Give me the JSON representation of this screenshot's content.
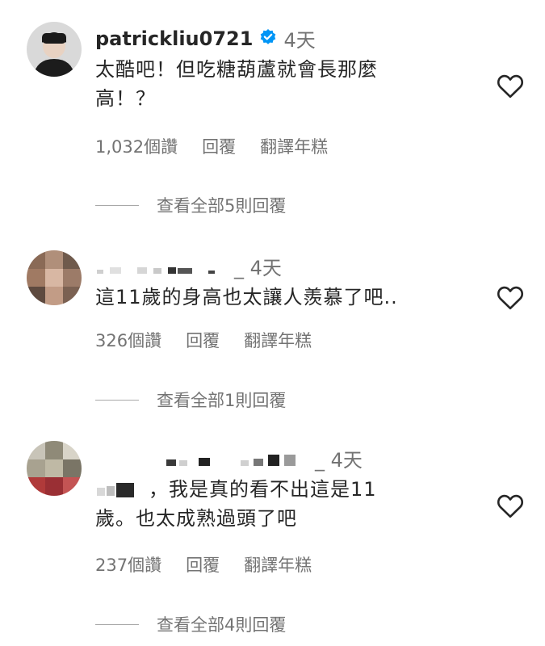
{
  "comments": [
    {
      "username": "patrickliu0721",
      "verified": true,
      "time": "4天",
      "text_line1": "太酷吧！但吃糖葫蘆就會長那麼",
      "text_line2": "高！？",
      "likes": "1,032個讚",
      "reply_label": "回覆",
      "translate_label": "翻譯年糕",
      "view_replies": "查看全部5則回覆"
    },
    {
      "username": "",
      "time": "_ 4天",
      "text_line1": "這11歲的身高也太讓人羨慕了吧..",
      "likes": "326個讚",
      "reply_label": "回覆",
      "translate_label": "翻譯年糕",
      "view_replies": "查看全部1則回覆"
    },
    {
      "username": "",
      "time": "_ 4天",
      "text_line1": "，我是真的看不出這是11",
      "text_line2": "歲。也太成熟過頭了吧",
      "likes": "237個讚",
      "reply_label": "回覆",
      "translate_label": "翻譯年糕",
      "view_replies": "查看全部4則回覆"
    }
  ],
  "icons": {
    "verified": "verified-badge-icon",
    "like": "heart-outline-icon"
  },
  "colors": {
    "text": "#262626",
    "secondary": "#737373",
    "verified_blue": "#0095f6"
  }
}
